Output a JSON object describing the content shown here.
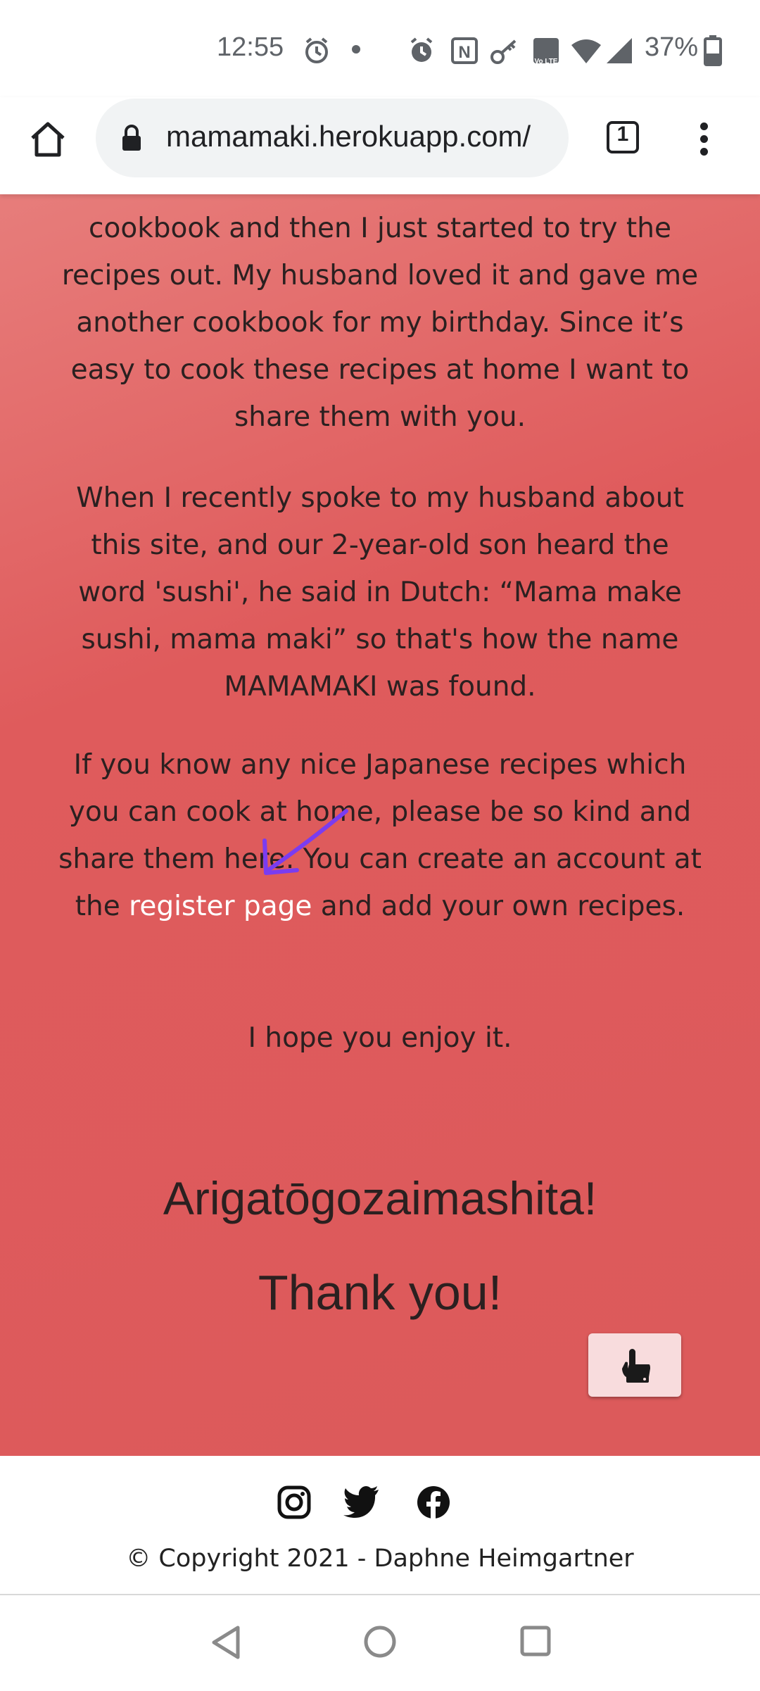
{
  "status_bar": {
    "time": "12:55",
    "battery_percent": "37%",
    "nfc_label": "N",
    "volte_label": "Vo LTE"
  },
  "browser": {
    "url": "mamamaki.herokuapp.com/",
    "tab_count": "1"
  },
  "content": {
    "para1": "cookbook and then I just started to try the recipes out. My husband loved it and gave me another cookbook for my birthday. Since it’s easy to cook these recipes at home I want to share them with you.",
    "para2": "When I recently spoke to my husband about this site, and our 2-year-old son heard the word 'sushi', he said in Dutch: “Mama make sushi, mama maki” so that's how the name MAMAMAKI was found.",
    "para3_before": "If you know any nice Japanese recipes which you can cook at home, please be so kind and share them here. You can create an account at the ",
    "register_link": "register page",
    "para3_after": " and add your own recipes.",
    "para4": "I hope you enjoy it.",
    "thanks_japanese": "Arigatōgozaimashita!",
    "thanks_english": "Thank you!"
  },
  "footer": {
    "copyright": "© Copyright 2021 - Daphne Heimgartner"
  },
  "colors": {
    "content_bg": "#dc5a5b",
    "link": "#ffffff",
    "annotation_arrow": "#7a3cf0",
    "scroll_button_bg": "#f8dcdd"
  },
  "icons": [
    "alarm-icon",
    "nfc-icon",
    "key-icon",
    "volte-icon",
    "wifi-icon",
    "signal-icon",
    "battery-icon",
    "home-icon",
    "lock-icon",
    "tab-switcher-icon",
    "more-menu-icon",
    "hand-pointer-icon",
    "instagram-icon",
    "twitter-icon",
    "facebook-icon",
    "nav-back-icon",
    "nav-home-icon",
    "nav-recents-icon"
  ]
}
